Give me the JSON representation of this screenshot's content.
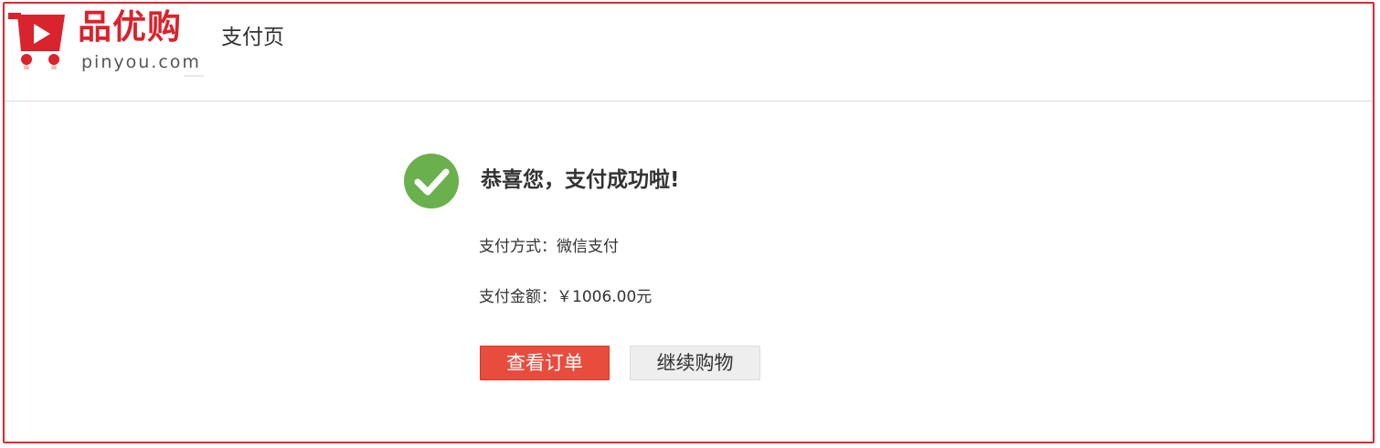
{
  "header": {
    "logo_text": "品优购",
    "logo_domain": "pinyou.com",
    "page_title": "支付页"
  },
  "result": {
    "title": "恭喜您，支付成功啦!",
    "method_label": "支付方式：",
    "method_value": "微信支付",
    "amount_label": "支付金额：",
    "amount_value": "￥1006.00元"
  },
  "actions": {
    "view_order": "查看订单",
    "continue_shopping": "继续购物"
  },
  "icons": {
    "logo": "shopping-cart-icon",
    "success": "check-circle-icon"
  },
  "colors": {
    "brand_red": "#d9232d",
    "success_green": "#6ab04c",
    "primary_button": "#e84c3d",
    "secondary_button": "#eeeeee"
  }
}
